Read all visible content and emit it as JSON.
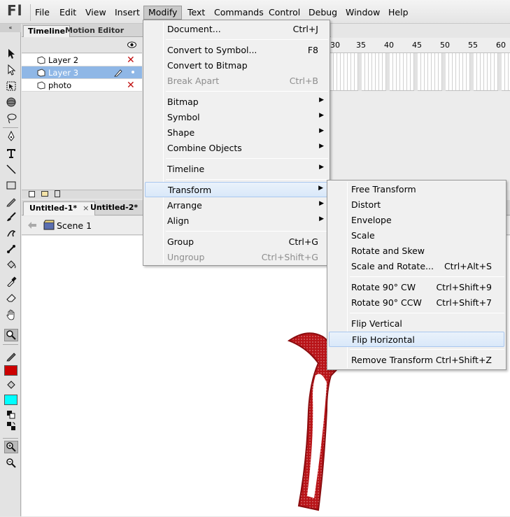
{
  "app": {
    "logo": "Fl"
  },
  "menubar": [
    "File",
    "Edit",
    "View",
    "Insert",
    "Modify",
    "Text",
    "Commands",
    "Control",
    "Debug",
    "Window",
    "Help"
  ],
  "timeline": {
    "tabs": [
      "Timeline",
      "Motion Editor"
    ],
    "layers": [
      {
        "name": "Layer 2",
        "selected": false
      },
      {
        "name": "Layer 3",
        "selected": true
      },
      {
        "name": "photo",
        "selected": false
      }
    ],
    "frame_numbers": [
      "30",
      "35",
      "40",
      "45",
      "50",
      "55",
      "60"
    ]
  },
  "documents": {
    "tabs": [
      "Untitled-1*",
      "Untitled-2*"
    ],
    "close_glyph": "×",
    "scene": "Scene 1"
  },
  "modify_menu": {
    "items": [
      {
        "label": "Document...",
        "shortcut": "Ctrl+J"
      },
      {
        "label": "Convert to Symbol...",
        "shortcut": "F8"
      },
      {
        "label": "Convert to Bitmap",
        "shortcut": ""
      },
      {
        "label": "Break Apart",
        "shortcut": "Ctrl+B",
        "disabled": true
      },
      {
        "label": "Bitmap",
        "submenu": true
      },
      {
        "label": "Symbol",
        "submenu": true
      },
      {
        "label": "Shape",
        "submenu": true
      },
      {
        "label": "Combine Objects",
        "submenu": true
      },
      {
        "label": "Timeline",
        "submenu": true
      },
      {
        "label": "Transform",
        "submenu": true,
        "highlighted": true
      },
      {
        "label": "Arrange",
        "submenu": true
      },
      {
        "label": "Align",
        "submenu": true
      },
      {
        "label": "Group",
        "shortcut": "Ctrl+G"
      },
      {
        "label": "Ungroup",
        "shortcut": "Ctrl+Shift+G",
        "disabled": true
      }
    ]
  },
  "transform_menu": {
    "items": [
      {
        "label": "Free Transform",
        "shortcut": ""
      },
      {
        "label": "Distort",
        "shortcut": ""
      },
      {
        "label": "Envelope",
        "shortcut": ""
      },
      {
        "label": "Scale",
        "shortcut": ""
      },
      {
        "label": "Rotate and Skew",
        "shortcut": ""
      },
      {
        "label": "Scale and Rotate...",
        "shortcut": "Ctrl+Alt+S"
      },
      {
        "label": "Rotate 90° CW",
        "shortcut": "Ctrl+Shift+9"
      },
      {
        "label": "Rotate 90° CCW",
        "shortcut": "Ctrl+Shift+7"
      },
      {
        "label": "Flip Vertical",
        "shortcut": ""
      },
      {
        "label": "Flip Horizontal",
        "shortcut": "",
        "highlighted": true
      },
      {
        "label": "Remove Transform",
        "shortcut": "Ctrl+Shift+Z"
      }
    ]
  },
  "colors": {
    "stroke": "#cc0000",
    "fill": "#00ffff",
    "arrow": "#b81418",
    "selection": "#8fb7e6"
  }
}
